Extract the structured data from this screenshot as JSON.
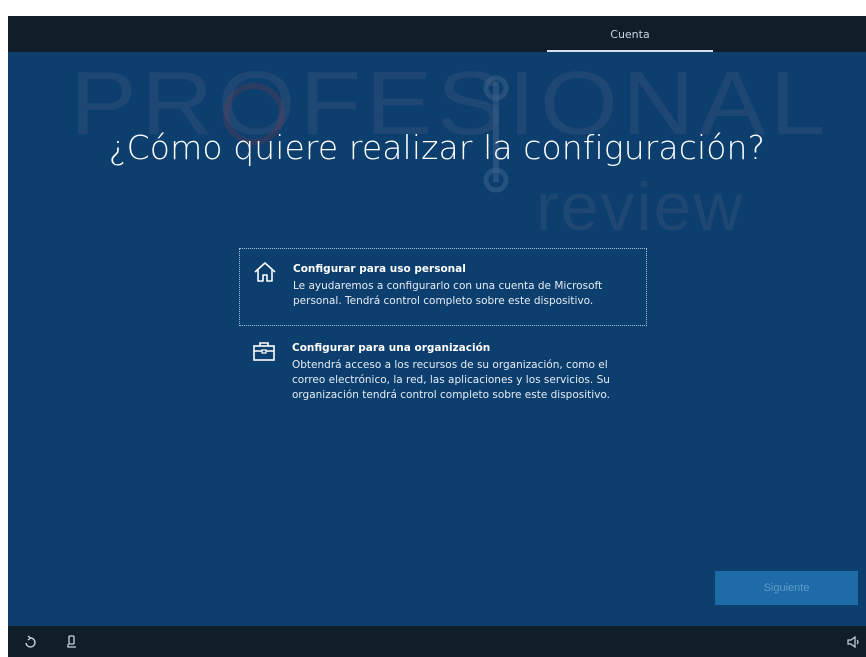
{
  "header": {
    "tab_label": "Cuenta"
  },
  "main": {
    "title": "¿Cómo quiere realizar la configuración?",
    "options": [
      {
        "icon": "home-icon",
        "title": "Configurar para uso personal",
        "description": "Le ayudaremos a configurarlo con una cuenta de Microsoft personal. Tendrá control completo sobre este dispositivo."
      },
      {
        "icon": "briefcase-icon",
        "title": "Configurar para una organización",
        "description": "Obtendrá acceso a los recursos de su organización, como el correo electrónico, la red, las aplicaciones y los servicios. Su organización tendrá control completo sobre este dispositivo."
      }
    ]
  },
  "footer": {
    "next_label": "Siguiente",
    "icons": [
      "accessibility-icon",
      "microphone-icon",
      "volume-icon"
    ]
  },
  "watermark": {
    "line1": "PROFESIONAL",
    "line2": "review"
  },
  "colors": {
    "background": "#0c3e6e",
    "bar": "#101e2a",
    "button": "#1d6ba8"
  }
}
